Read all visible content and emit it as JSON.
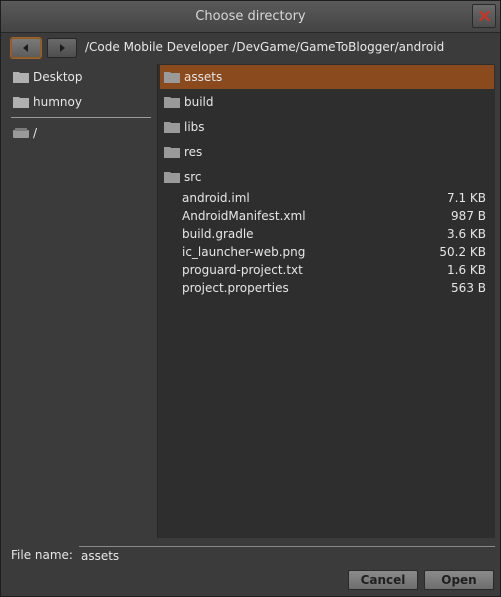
{
  "window": {
    "title": "Choose directory"
  },
  "pathbar": {
    "path": "/Code Mobile Developer /DevGame/GameToBlogger/android"
  },
  "sidebar": {
    "places": [
      {
        "label": "Desktop",
        "icon": "folder-icon"
      },
      {
        "label": "humnoy",
        "icon": "folder-icon"
      }
    ],
    "devices": [
      {
        "label": "/",
        "icon": "drive-icon"
      }
    ]
  },
  "files": {
    "folders": [
      {
        "name": "assets",
        "selected": true
      },
      {
        "name": "build"
      },
      {
        "name": "libs"
      },
      {
        "name": "res"
      },
      {
        "name": "src"
      }
    ],
    "items": [
      {
        "name": "android.iml",
        "size": "7.1 KB"
      },
      {
        "name": "AndroidManifest.xml",
        "size": "987 B"
      },
      {
        "name": "build.gradle",
        "size": "3.6 KB"
      },
      {
        "name": "ic_launcher-web.png",
        "size": "50.2 KB"
      },
      {
        "name": "proguard-project.txt",
        "size": "1.6 KB"
      },
      {
        "name": "project.properties",
        "size": "563 B"
      }
    ]
  },
  "footer": {
    "filename_label": "File name:",
    "filename_value": "assets",
    "cancel_label": "Cancel",
    "open_label": "Open"
  },
  "colors": {
    "selection": "#8b4a1e",
    "close_x": "#c0392b"
  }
}
